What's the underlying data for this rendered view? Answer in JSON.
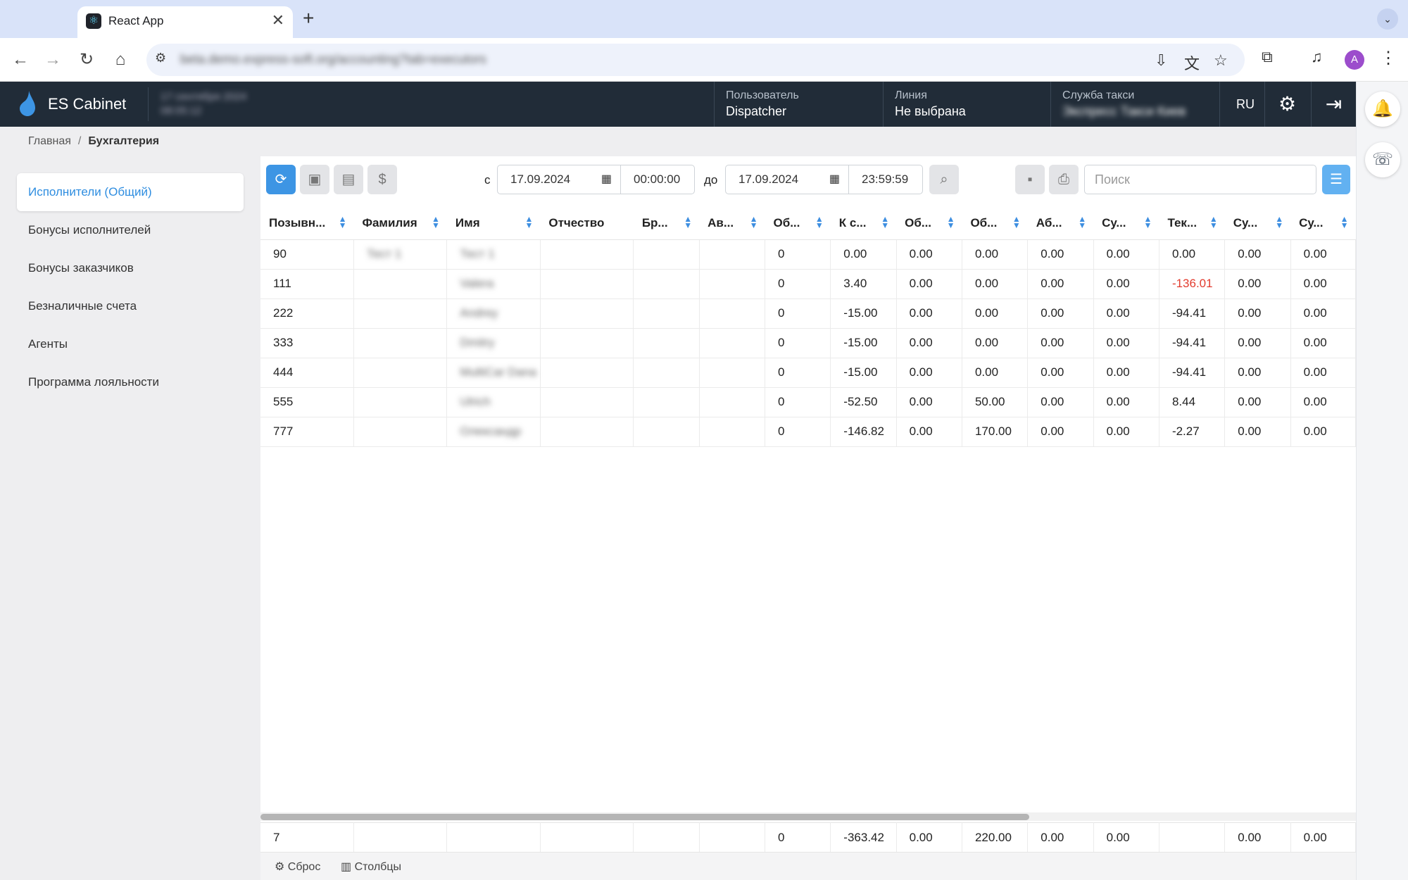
{
  "browser": {
    "tab_title": "React App",
    "url": "beta.demo.express-soft.org/accounting?tab=executors",
    "profile_initial": "A"
  },
  "header": {
    "app_name": "ES Cabinet",
    "datetime": [
      "17 сентября 2024",
      "08:05:12"
    ],
    "user_label": "Пользователь",
    "user_value": "Dispatcher",
    "line_label": "Линия",
    "line_value": "Не выбрана",
    "service_label": "Служба такси",
    "service_value": "Экспресс Такси Киев",
    "lang": "RU"
  },
  "breadcrumb": {
    "home": "Главная",
    "sep": "/",
    "current": "Бухгалтерия"
  },
  "sidebar": {
    "items": [
      {
        "label": "Исполнители (Общий)",
        "active": true
      },
      {
        "label": "Бонусы исполнителей"
      },
      {
        "label": "Бонусы заказчиков"
      },
      {
        "label": "Безналичные счета"
      },
      {
        "label": "Агенты"
      },
      {
        "label": "Программа лояльности"
      }
    ]
  },
  "toolbar": {
    "from_label": "с",
    "from_date": "17.09.2024",
    "from_time": "00:00:00",
    "to_label": "до",
    "to_date": "17.09.2024",
    "to_time": "23:59:59",
    "search_placeholder": "Поиск"
  },
  "table": {
    "columns": [
      "Позывн...",
      "Фамилия",
      "Имя",
      "Отчество",
      "Бр...",
      "Ав...",
      "Об...",
      "К с...",
      "Об...",
      "Об...",
      "Аб...",
      "Су...",
      "Тек...",
      "Су...",
      "Су..."
    ],
    "rows": [
      [
        "90",
        "Тест 1",
        "Тест 1",
        "",
        "",
        "",
        "0",
        "0.00",
        "0.00",
        "0.00",
        "0.00",
        "0.00",
        "0.00",
        "0.00",
        "0.00"
      ],
      [
        "111",
        "",
        "Valera",
        "",
        "",
        "",
        "0",
        "3.40",
        "0.00",
        "0.00",
        "0.00",
        "0.00",
        "-136.01",
        "0.00",
        "0.00"
      ],
      [
        "222",
        "",
        "Andrey",
        "",
        "",
        "",
        "0",
        "-15.00",
        "0.00",
        "0.00",
        "0.00",
        "0.00",
        "-94.41",
        "0.00",
        "0.00"
      ],
      [
        "333",
        "",
        "Dmitry",
        "",
        "",
        "",
        "0",
        "-15.00",
        "0.00",
        "0.00",
        "0.00",
        "0.00",
        "-94.41",
        "0.00",
        "0.00"
      ],
      [
        "444",
        "",
        "MultiCar Dana",
        "",
        "",
        "",
        "0",
        "-15.00",
        "0.00",
        "0.00",
        "0.00",
        "0.00",
        "-94.41",
        "0.00",
        "0.00"
      ],
      [
        "555",
        "",
        "Ulrich",
        "",
        "",
        "",
        "0",
        "-52.50",
        "0.00",
        "50.00",
        "0.00",
        "0.00",
        "8.44",
        "0.00",
        "0.00"
      ],
      [
        "777",
        "",
        "Олександр",
        "",
        "",
        "",
        "0",
        "-146.82",
        "0.00",
        "170.00",
        "0.00",
        "0.00",
        "-2.27",
        "0.00",
        "0.00"
      ]
    ],
    "totals": [
      "7",
      "",
      "",
      "",
      "",
      "",
      "0",
      "-363.42",
      "0.00",
      "220.00",
      "0.00",
      "0.00",
      "",
      "0.00",
      "0.00"
    ],
    "negative_color": "#e23b2e"
  },
  "footer": {
    "reset_label": "Сброс",
    "columns_label": "Столбцы"
  }
}
